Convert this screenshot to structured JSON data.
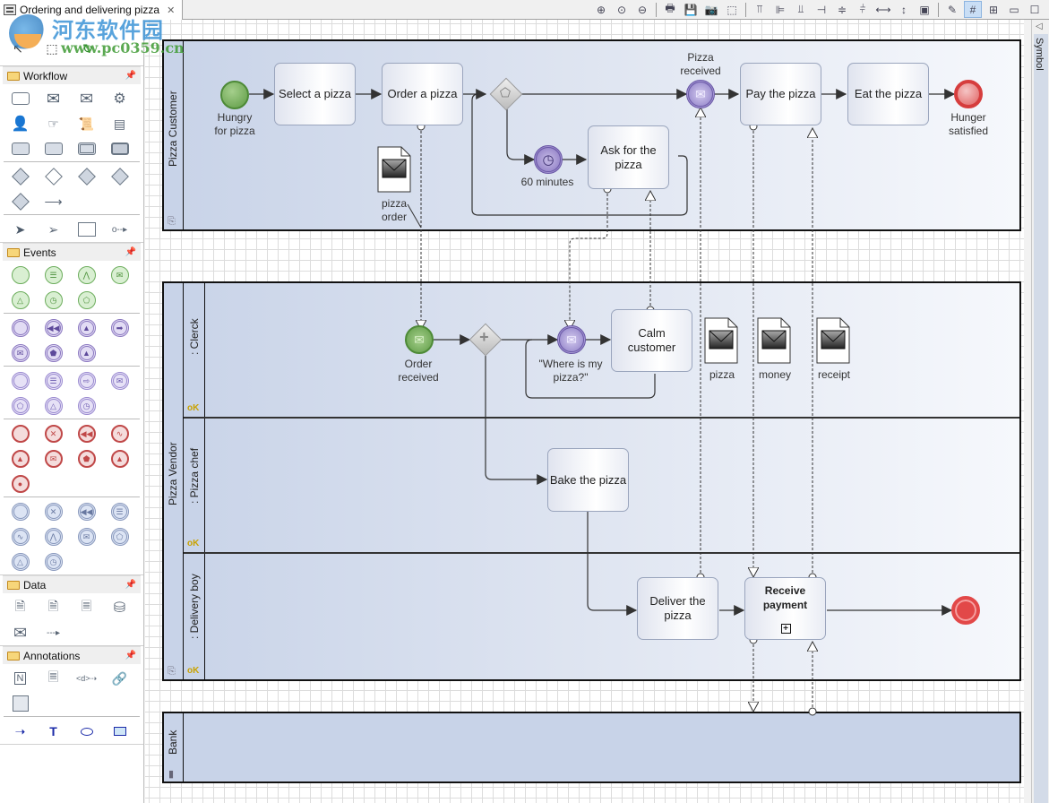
{
  "editor": {
    "tab_title": "Ordering and delivering pizza",
    "close_glyph": "✕"
  },
  "toolbar": {
    "buttons": [
      {
        "name": "zoom-in",
        "glyph": "⊕"
      },
      {
        "name": "zoom-reset",
        "glyph": "⊙"
      },
      {
        "name": "zoom-out",
        "glyph": "⊖"
      },
      {
        "name": "print",
        "glyph": "🖶"
      },
      {
        "name": "save",
        "glyph": "💾"
      },
      {
        "name": "snapshot",
        "glyph": "📷"
      },
      {
        "name": "select-area",
        "glyph": "⬚"
      },
      {
        "name": "align-top",
        "glyph": "⫪"
      },
      {
        "name": "align-left",
        "glyph": "⊫"
      },
      {
        "name": "align-bottom",
        "glyph": "⫫"
      },
      {
        "name": "align-right",
        "glyph": "⊣"
      },
      {
        "name": "center-vertical",
        "glyph": "≑"
      },
      {
        "name": "center-horizontal",
        "glyph": "⫩"
      },
      {
        "name": "same-width",
        "glyph": "⟷"
      },
      {
        "name": "same-height",
        "glyph": "↕"
      },
      {
        "name": "same-size",
        "glyph": "▣"
      },
      {
        "name": "format-painter",
        "glyph": "✎"
      },
      {
        "name": "grid-toggle",
        "glyph": "#",
        "active": true
      },
      {
        "name": "snap-toggle",
        "glyph": "⊞"
      },
      {
        "name": "minimize",
        "glyph": "▭"
      },
      {
        "name": "maximize",
        "glyph": "☐"
      }
    ]
  },
  "palette": {
    "tools": [
      {
        "name": "select",
        "glyph": "↖"
      },
      {
        "name": "marquee",
        "glyph": "⬚"
      },
      {
        "name": "connection",
        "glyph": "↻"
      }
    ],
    "drawers": [
      {
        "label": "Workflow",
        "pin": "📌",
        "groups": [
          [
            "task",
            "message-filled",
            "message",
            "service"
          ],
          [
            "user",
            "manual",
            "script",
            "business-rule"
          ],
          [
            "subprocess-collapsed",
            "ad-hoc",
            "call-activity",
            "transaction"
          ],
          [
            "gateway",
            "gateway-inclusive",
            "gateway-complex",
            "gateway-parallel"
          ],
          [
            "gateway-event",
            "sequence-flow"
          ],
          [
            "lane-chevron",
            "lane-link",
            "pool",
            "message-flow"
          ]
        ]
      },
      {
        "label": "Events",
        "pin": "📌",
        "groups": [
          {
            "kind": "st",
            "glyphs": [
              "",
              "☰",
              "⋀",
              "✉",
              "△",
              "◷",
              "⬠"
            ]
          },
          {
            "kind": "ic",
            "glyphs": [
              "",
              "◀◀",
              "▲",
              "➡",
              "✉",
              "⬟",
              "▲"
            ]
          },
          {
            "kind": "ib",
            "glyphs": [
              "",
              "☰",
              "⇨",
              "✉",
              "⬠",
              "△",
              "◷"
            ]
          },
          {
            "kind": "en",
            "glyphs": [
              "",
              "✕",
              "◀◀",
              "∿",
              "▲",
              "✉",
              "⬟",
              "▲",
              "●"
            ]
          },
          {
            "kind": "bd",
            "glyphs": [
              "",
              "✕",
              "◀◀",
              "☰",
              "∿",
              "⋀",
              "✉",
              "⬠",
              "△",
              "◷"
            ]
          }
        ]
      },
      {
        "label": "Data",
        "pin": "📌",
        "groups": [
          [
            "data-input",
            "data-output",
            "data-object",
            "data-store"
          ],
          [
            "message",
            "data-association"
          ]
        ]
      },
      {
        "label": "Annotations",
        "pin": "📌",
        "groups": [
          [
            "note",
            "text-annotation",
            "association",
            "link"
          ],
          [
            "image"
          ]
        ]
      },
      {
        "label": "",
        "groups": [
          [
            "arrow",
            "text",
            "ellipse",
            "rectangle"
          ]
        ]
      }
    ],
    "extra_glyphs": {
      "arrow": "➝",
      "text": "T",
      "ellipse": "⬭",
      "rectangle": "▭"
    }
  },
  "diagram": {
    "pools": [
      {
        "label": "Pizza Customer"
      },
      {
        "label": "Pizza Vendor",
        "lanes": [
          {
            "label": ": Clerck"
          },
          {
            "label": ": Pizza chef"
          },
          {
            "label": ": Delivery boy"
          }
        ]
      },
      {
        "label": "Bank"
      }
    ],
    "events": [
      {
        "id": "hungry",
        "label": "Hungry\nfor pizza",
        "type": "start"
      },
      {
        "id": "timer",
        "label": "60 minutes",
        "type": "intermediate-timer"
      },
      {
        "id": "pizza-received",
        "label": "Pizza\nreceived",
        "type": "intermediate-message"
      },
      {
        "id": "hunger-satisfied",
        "label": "Hunger\nsatisfied",
        "type": "end"
      },
      {
        "id": "order-received",
        "label": "Order\nreceived",
        "type": "start-message"
      },
      {
        "id": "where-is-my-pizza",
        "label": "\"Where is my\npizza?\"",
        "type": "intermediate-message"
      },
      {
        "id": "vendor-end",
        "label": "",
        "type": "end"
      }
    ],
    "tasks": [
      {
        "id": "select",
        "label": "Select a pizza"
      },
      {
        "id": "order",
        "label": "Order a pizza"
      },
      {
        "id": "ask",
        "label": "Ask for the\npizza"
      },
      {
        "id": "pay",
        "label": "Pay the pizza"
      },
      {
        "id": "eat",
        "label": "Eat the pizza"
      },
      {
        "id": "calm",
        "label": "Calm\ncustomer"
      },
      {
        "id": "bake",
        "label": "Bake the pizza"
      },
      {
        "id": "deliver",
        "label": "Deliver the\npizza"
      },
      {
        "id": "receive-payment",
        "label": "Receive\npayment",
        "subprocess": true
      }
    ],
    "gateways": [
      {
        "id": "event-gateway",
        "type": "event-based"
      },
      {
        "id": "parallel-gateway",
        "type": "parallel"
      }
    ],
    "data_objects": [
      {
        "id": "pizza-order",
        "label": "pizza\norder"
      },
      {
        "id": "pizza",
        "label": "pizza"
      },
      {
        "id": "money",
        "label": "money"
      },
      {
        "id": "receipt",
        "label": "receipt"
      }
    ]
  },
  "right_panel": {
    "label": "Symbol",
    "collapse_glyph": "◁"
  },
  "watermark": {
    "title": "河东软件园",
    "url": "www.pc0359.cn"
  }
}
